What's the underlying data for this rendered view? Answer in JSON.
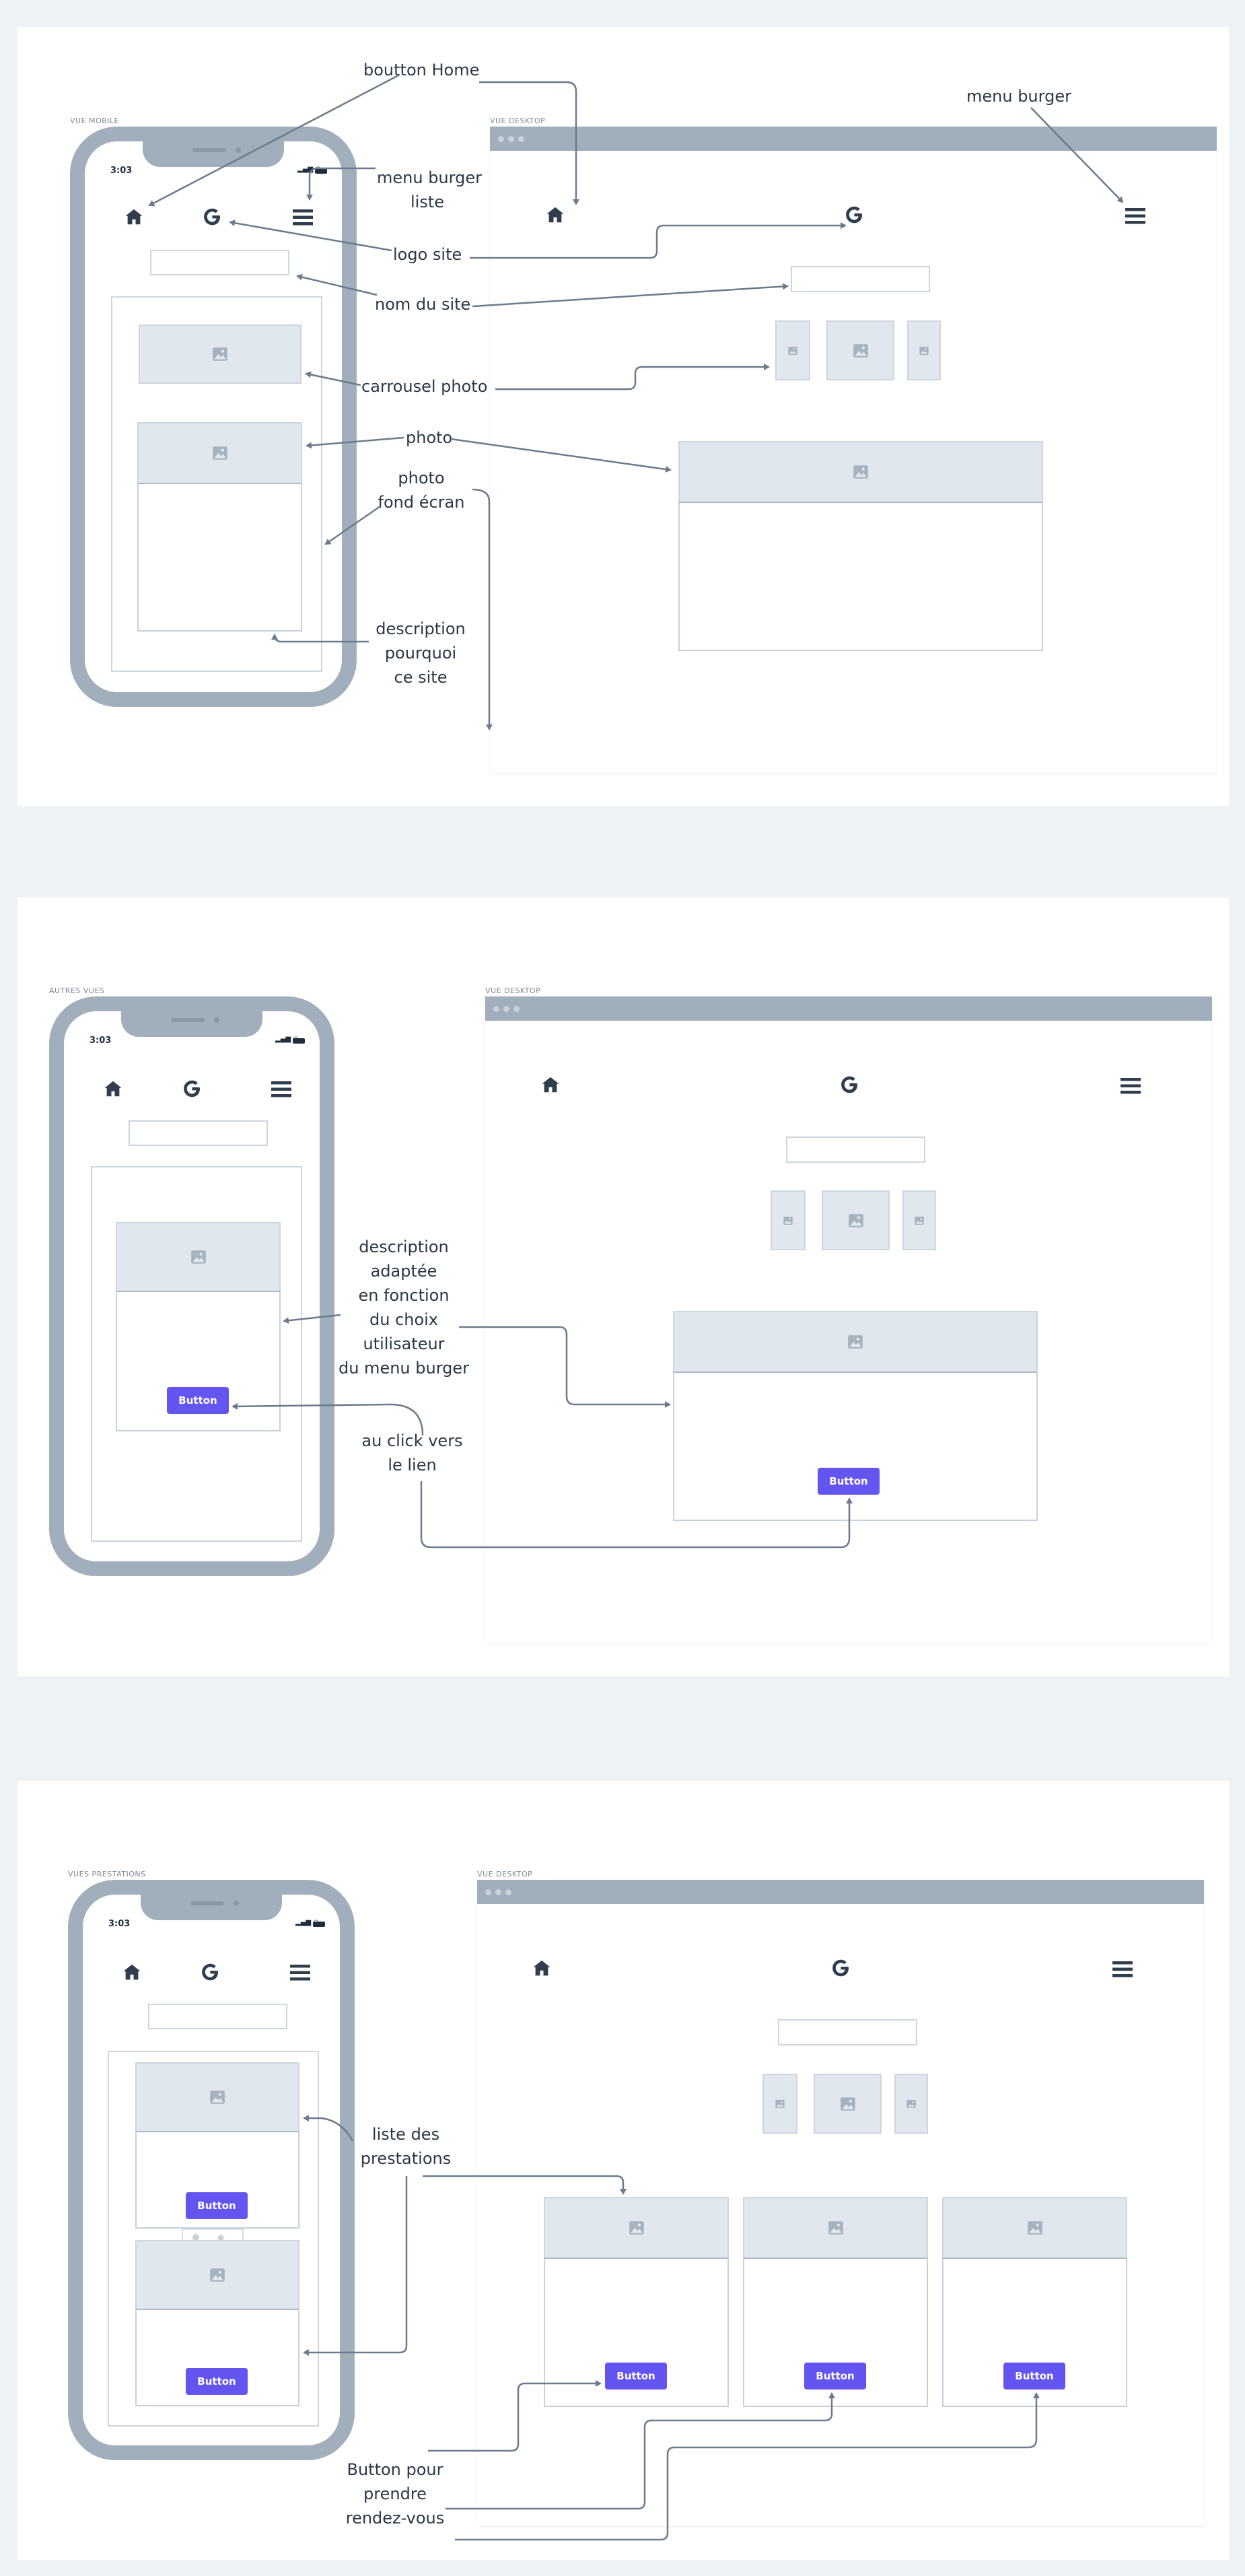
{
  "phone_status": {
    "time": "3:03"
  },
  "button_label": "Button",
  "sections": [
    {
      "mobile_caption": "VUE MOBILE",
      "desktop_caption": "VUE DESKTOP",
      "annotations": {
        "home": "boutton Home",
        "menu_desktop": "menu burger",
        "menu_mobile": [
          "menu burger",
          "liste"
        ],
        "logo": "logo site",
        "name": "nom du site",
        "carousel": "carrousel photo",
        "photo": "photo",
        "background": [
          "photo",
          "fond écran"
        ],
        "description": [
          "description",
          "pourquoi",
          "ce site"
        ]
      }
    },
    {
      "mobile_caption": "AUTRES VUES",
      "desktop_caption": "VUE DESKTOP",
      "annotations": {
        "description": [
          "description",
          "adaptée",
          "en fonction",
          "du choix",
          "utilisateur",
          "du menu burger"
        ],
        "click": [
          "au click vers",
          "le lien"
        ]
      }
    },
    {
      "mobile_caption": "VUES PRESTATIONS",
      "desktop_caption": "VUE DESKTOP",
      "annotations": {
        "list": [
          "liste des",
          "prestations"
        ],
        "booking": [
          "Button pour",
          "prendre",
          "rendez-vous"
        ]
      }
    }
  ],
  "icons": [
    "home-icon",
    "google-logo-icon",
    "hamburger-menu-icon",
    "image-placeholder-icon"
  ],
  "colors": {
    "frame": "#a0afbb",
    "button": "#6454f0",
    "arrow": "#6b7b8b",
    "icon": "#2f3d4d"
  }
}
